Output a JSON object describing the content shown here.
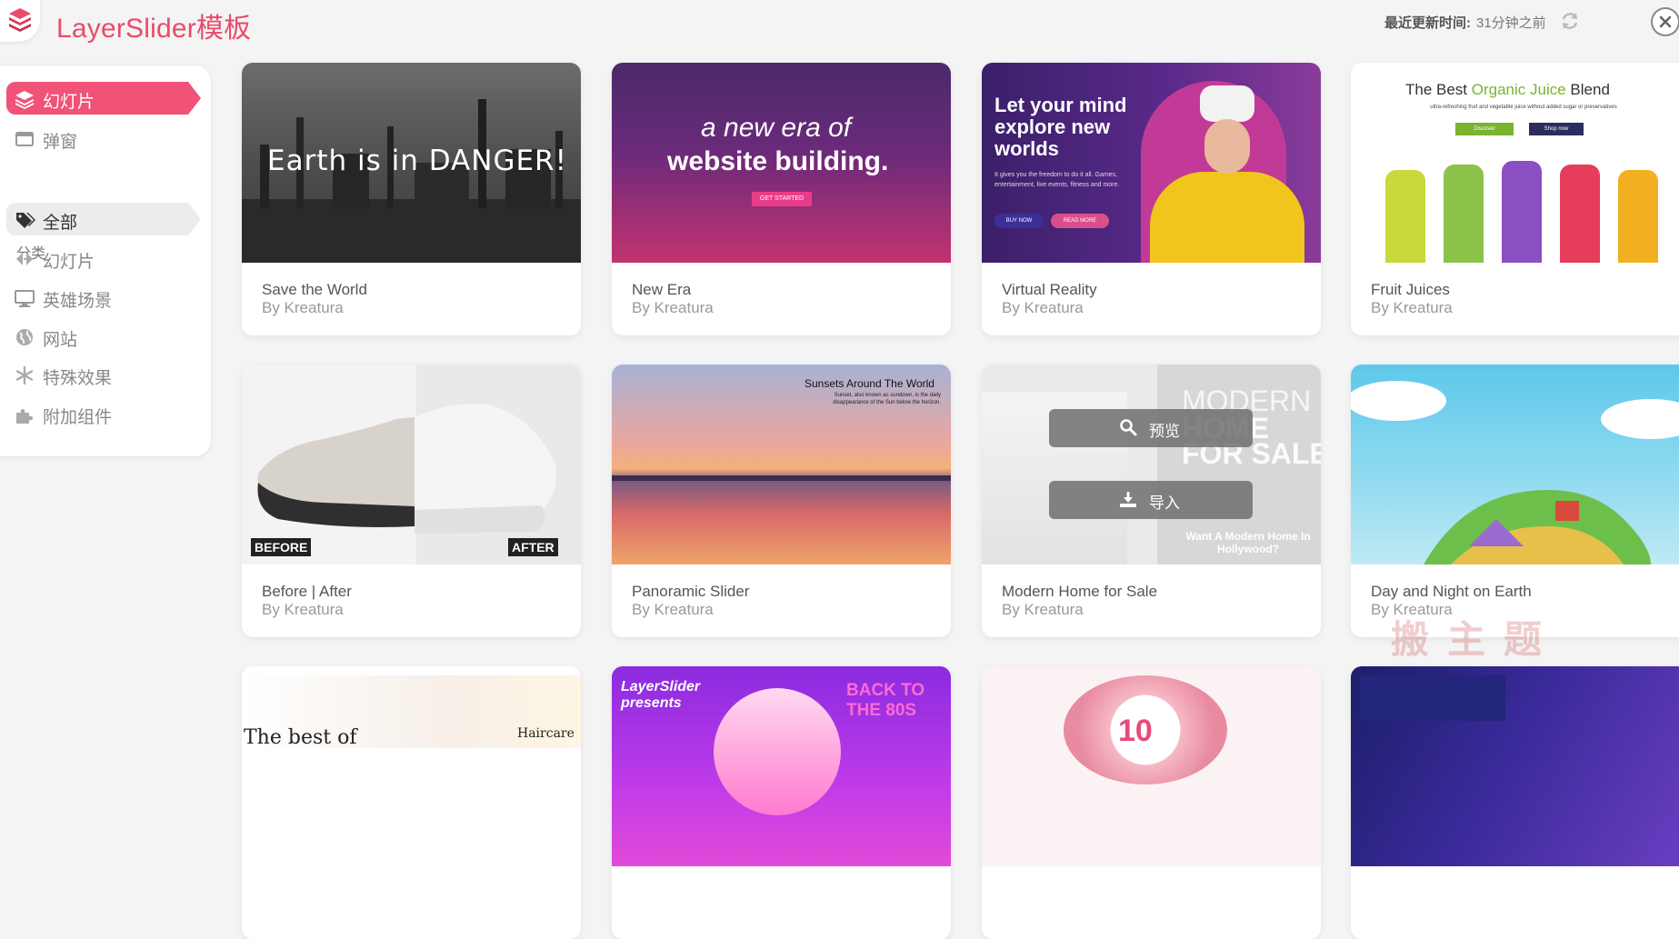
{
  "header": {
    "title": "LayerSlider模板",
    "last_update_label": "最近更新时间:",
    "last_update_value": "31分钟之前"
  },
  "sidebar": {
    "items": [
      {
        "label": "幻灯片",
        "icon": "layers-icon"
      },
      {
        "label": "弹窗",
        "icon": "window-icon"
      }
    ],
    "section_label": "分类",
    "categories": [
      {
        "label": "全部",
        "icon": "tags-icon"
      },
      {
        "label": "幻灯片",
        "icon": "arrows-icon"
      },
      {
        "label": "英雄场景",
        "icon": "desktop-icon"
      },
      {
        "label": "网站",
        "icon": "globe-icon"
      },
      {
        "label": "特殊效果",
        "icon": "snowflake-icon"
      },
      {
        "label": "附加组件",
        "icon": "puzzle-icon"
      }
    ]
  },
  "cards": [
    {
      "title": "Save the World",
      "author": "By Kreatura",
      "thumb_text": "Earth is in DANGER!"
    },
    {
      "title": "New Era",
      "author": "By Kreatura",
      "thumb_line1": "a new era of",
      "thumb_line2": "website building.",
      "thumb_btn": "GET STARTED"
    },
    {
      "title": "Virtual Reality",
      "author": "By Kreatura",
      "thumb_heading": "Let your mind explore new worlds",
      "thumb_sub": "It gives you the freedom to do it all. Games, entertainment, live events, fitness and more.",
      "thumb_btn1": "BUY NOW",
      "thumb_btn2": "READ MORE"
    },
    {
      "title": "Fruit Juices",
      "author": "By Kreatura",
      "thumb_heading_a": "The Best ",
      "thumb_heading_b": "Organic Juice",
      "thumb_heading_c": " Blend",
      "thumb_sub": "ultra-refreshing fruit and vegetable juice without added sugar or preservatives",
      "thumb_btn1": "Discover",
      "thumb_btn2": "Shop now"
    },
    {
      "title": "Before | After",
      "author": "By Kreatura",
      "label_before": "BEFORE",
      "label_after": "AFTER"
    },
    {
      "title": "Panoramic Slider",
      "author": "By Kreatura",
      "thumb_heading": "Sunsets Around The World",
      "thumb_sub": "Sunset, also known as sundown, is the daily disappearance of the Sun below the horizon."
    },
    {
      "title": "Modern Home for Sale",
      "author": "By Kreatura",
      "thumb_line1": "MODERN",
      "thumb_line2": "HOME",
      "thumb_line3": "FOR SALE",
      "thumb_question": "Want A Modern Home In Hollywood?",
      "preview_label": "预览",
      "import_label": "导入"
    },
    {
      "title": "Day and Night on Earth",
      "author": "By Kreatura"
    },
    {
      "thumb_text": "The best of",
      "thumb_tag": "Haircare"
    },
    {
      "thumb_text": "LayerSlider presents",
      "thumb_text2": "BACK TO THE 80S"
    },
    {
      "thumb_text": "10"
    },
    {}
  ],
  "colors": {
    "accent": "#f05278",
    "brand": "#e94b6a"
  }
}
